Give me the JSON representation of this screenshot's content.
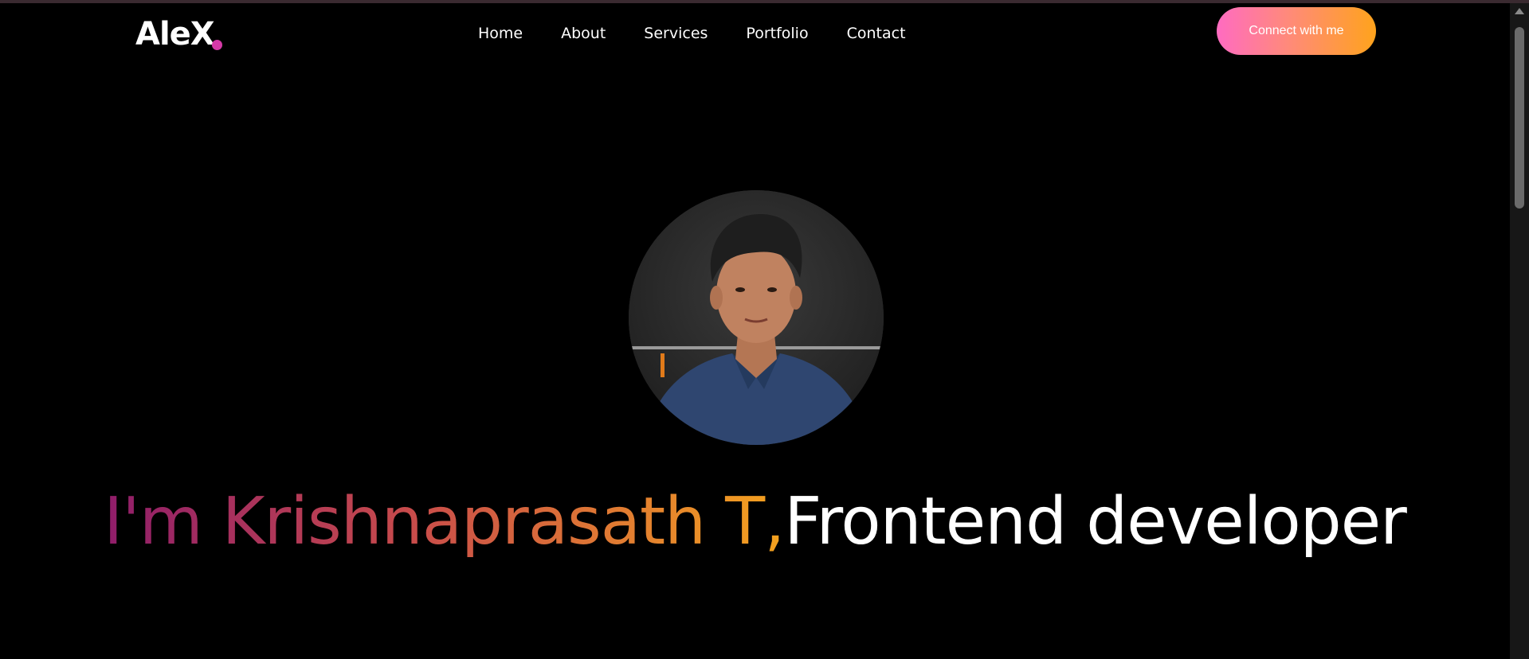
{
  "brand": {
    "logo_text": "AleX"
  },
  "nav": {
    "items": [
      {
        "label": "Home"
      },
      {
        "label": "About"
      },
      {
        "label": "Services"
      },
      {
        "label": "Portfolio"
      },
      {
        "label": "Contact"
      }
    ],
    "cta_label": "Connect with me"
  },
  "hero": {
    "greeting": "I'm Krishnaprasath T,",
    "role": "Frontend developer"
  },
  "colors": {
    "background": "#000000",
    "accent_pink": "#ff6bc1",
    "accent_orange": "#ffa31c",
    "logo_dot": "#d63aa8"
  },
  "icons": {
    "scroll_up": "chevron-up-icon"
  }
}
